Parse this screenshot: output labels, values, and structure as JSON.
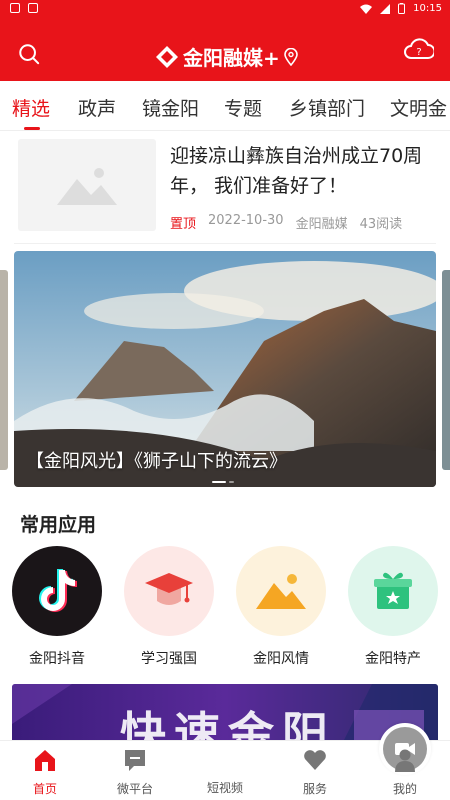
{
  "status": {
    "time": "10:15"
  },
  "header": {
    "logo_text": "金阳融媒+"
  },
  "tabs": [
    "精选",
    "政声",
    "镜金阳",
    "专题",
    "乡镇部门",
    "文明金"
  ],
  "news": {
    "title": "迎接凉山彝族自治州成立70周年， 我们准备好了！",
    "pin": "置顶",
    "date": "2022-10-30",
    "source": "金阳融媒",
    "reads": "43阅读"
  },
  "banner": {
    "caption": "【金阳风光】《狮子山下的流云》"
  },
  "apps_section": {
    "title": "常用应用",
    "items": [
      {
        "label": "金阳抖音",
        "icon": "douyin-icon"
      },
      {
        "label": "学习强国",
        "icon": "graduation-cap-icon"
      },
      {
        "label": "金阳风情",
        "icon": "image-icon"
      },
      {
        "label": "金阳特产",
        "icon": "gift-icon"
      }
    ]
  },
  "promo": {
    "text": "快速金阳"
  },
  "bottom_nav": [
    {
      "label": "首页",
      "icon": "home-icon"
    },
    {
      "label": "微平台",
      "icon": "message-icon"
    },
    {
      "label": "短视频",
      "icon": "video-icon"
    },
    {
      "label": "服务",
      "icon": "heart-icon"
    },
    {
      "label": "我的",
      "icon": "user-icon"
    }
  ],
  "colors": {
    "brand_red": "#e8141a"
  }
}
